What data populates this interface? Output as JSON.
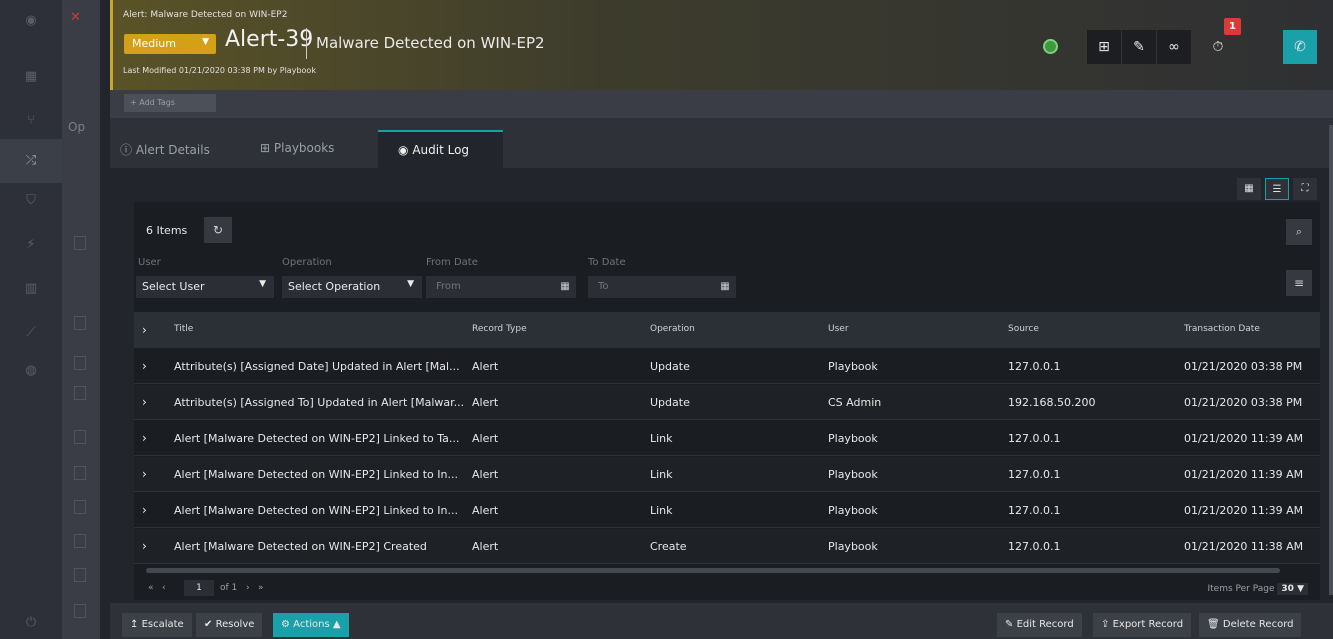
{
  "rail": {
    "icons": [
      "logo-icon",
      "dashboard-icon",
      "hierarchy-icon",
      "shuffle-icon",
      "shield-icon",
      "bolt-icon",
      "building-icon",
      "chart-icon",
      "globe-icon",
      "power-icon"
    ]
  },
  "header": {
    "breadcrumb": "Alert: Malware Detected on WIN-EP2",
    "severity": "Medium",
    "alert_id": "Alert-39",
    "title": "Malware Detected on WIN-EP2",
    "last_modified": "Last Modified 01/21/2020 03:38 PM by Playbook",
    "timer_badge": "1",
    "colors": {
      "severity": "#d4a017",
      "accent": "#1aa0a8",
      "badge": "#e03838"
    }
  },
  "tags": {
    "add_label": "+ Add Tags"
  },
  "tabs": [
    {
      "label": "Alert Details",
      "icon": "info-icon"
    },
    {
      "label": "Playbooks",
      "icon": "playbook-icon"
    },
    {
      "label": "Audit Log",
      "icon": "eye-icon"
    }
  ],
  "grid": {
    "item_count": "6 Items",
    "filters": {
      "user_label": "User",
      "user_value": "Select User",
      "operation_label": "Operation",
      "operation_value": "Select Operation",
      "from_label": "From Date",
      "from_placeholder": "From",
      "to_label": "To Date",
      "to_placeholder": "To"
    },
    "columns": [
      "Title",
      "Record Type",
      "Operation",
      "User",
      "Source",
      "Transaction Date"
    ],
    "rows": [
      [
        "Attribute(s) [Assigned Date] Updated in Alert [Mal...",
        "Alert",
        "Update",
        "Playbook",
        "127.0.0.1",
        "01/21/2020 03:38 PM"
      ],
      [
        "Attribute(s) [Assigned To] Updated in Alert [Malwar...",
        "Alert",
        "Update",
        "CS Admin",
        "192.168.50.200",
        "01/21/2020 03:38 PM"
      ],
      [
        "Alert [Malware Detected on WIN-EP2] Linked to Ta...",
        "Alert",
        "Link",
        "Playbook",
        "127.0.0.1",
        "01/21/2020 11:39 AM"
      ],
      [
        "Alert [Malware Detected on WIN-EP2] Linked to In...",
        "Alert",
        "Link",
        "Playbook",
        "127.0.0.1",
        "01/21/2020 11:39 AM"
      ],
      [
        "Alert [Malware Detected on WIN-EP2] Linked to In...",
        "Alert",
        "Link",
        "Playbook",
        "127.0.0.1",
        "01/21/2020 11:39 AM"
      ],
      [
        "Alert [Malware Detected on WIN-EP2] Created",
        "Alert",
        "Create",
        "Playbook",
        "127.0.0.1",
        "01/21/2020 11:38 AM"
      ]
    ],
    "pager": {
      "first": "«",
      "prev": "‹",
      "page": "1",
      "of_label": "of 1",
      "next": "›",
      "last": "»",
      "items_per_page_label": "Items Per Page",
      "items_per_page": "30"
    }
  },
  "footer": {
    "escalate": "Escalate",
    "resolve": "Resolve",
    "actions": "Actions",
    "edit_record": "Edit Record",
    "export_record": "Export Record",
    "delete_record": "Delete Record"
  }
}
